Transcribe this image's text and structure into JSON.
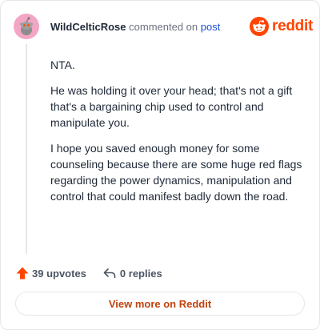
{
  "header": {
    "username": "WildCelticRose",
    "action_text": "commented on",
    "post_link": "post"
  },
  "brand": {
    "wordmark": "reddit",
    "color": "#ff4500"
  },
  "comment": {
    "paragraphs": [
      "NTA.",
      "He was holding it over your head; that's not a gift that's a bargaining chip used to control and manipulate you.",
      "I hope you saved enough money for some counseling because there are some huge red flags regarding the power dynamics, manipulation and control that could manifest badly down the road."
    ]
  },
  "footer": {
    "upvotes": "39 upvotes",
    "replies": "0 replies"
  },
  "view_more": {
    "label": "View more on Reddit"
  },
  "colors": {
    "upvote": "#ff4500",
    "link": "#1d4ed8",
    "view_more_text": "#c2410c",
    "avatar_bg": "#f2a5c4"
  },
  "icons": {
    "avatar": "snoo-avatar-icon",
    "logo": "reddit-logo-icon",
    "upvote": "upvote-arrow-icon",
    "reply": "reply-arrow-icon"
  }
}
